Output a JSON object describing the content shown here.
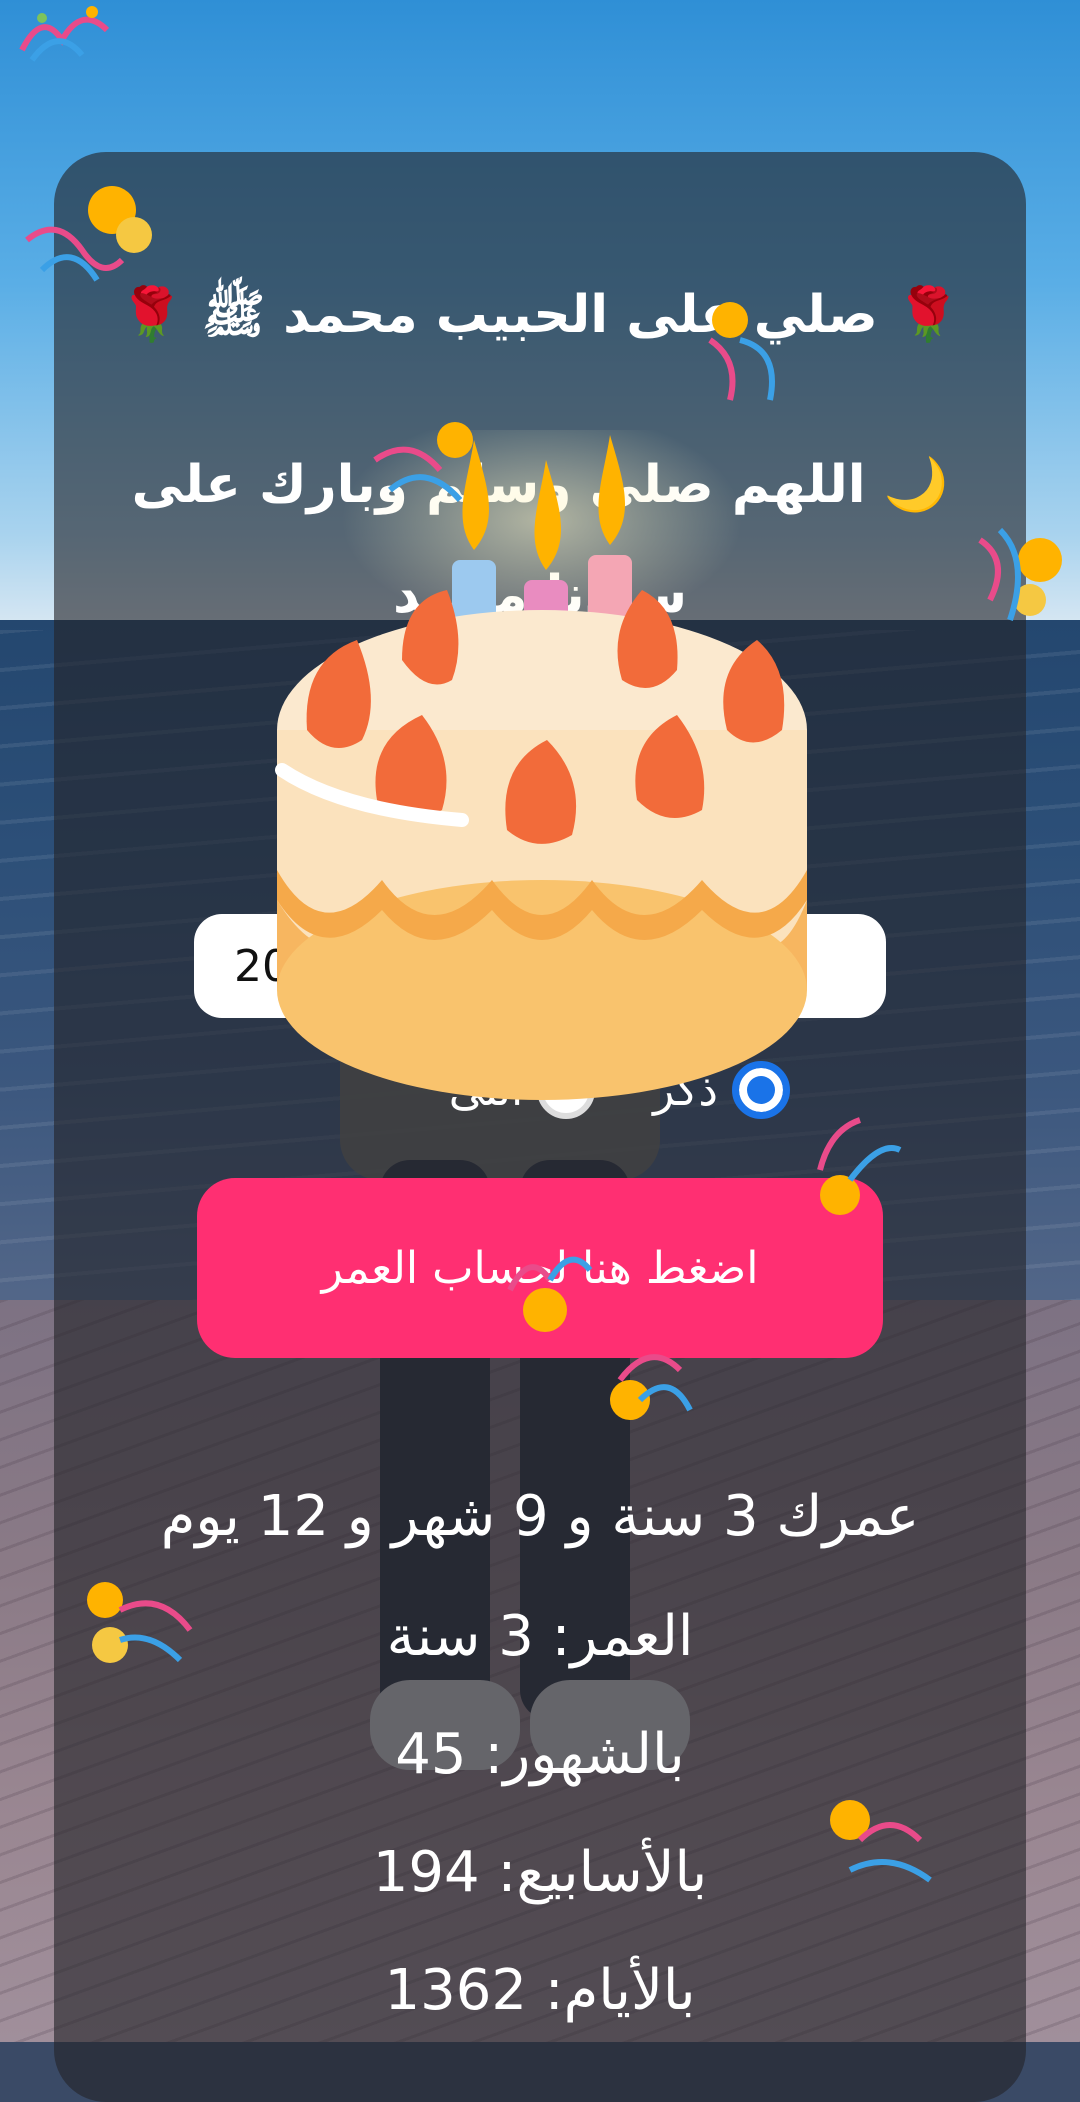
{
  "header": {
    "salawat_line": "🌹 صلي على الحبيب محمد ﷺ 🌹",
    "dua_line": "🌙 اللهم صلي وسلم وبارك على سيدنا محمد"
  },
  "birthdate_input": {
    "value": "20                                                2"
  },
  "gender": {
    "options": [
      {
        "label": "ذكر",
        "selected": true
      },
      {
        "label": "انثى",
        "selected": false
      }
    ]
  },
  "calculate_button": {
    "label": "اضغط هنا لحساب العمر"
  },
  "results": {
    "summary": "عمرك 3 سنة و 9 شهر و 12 يوم",
    "years": "العمر: 3 سنة",
    "months": "بالشهور: 45",
    "weeks": "بالأسابيع: 194",
    "days": "بالأيام: 1362"
  },
  "colors": {
    "button": "#ff2f72",
    "radio_selected": "#1a73e8",
    "card_overlay": "rgba(35,35,40,0.62)"
  },
  "icons": [
    "rose-icon",
    "crescent-moon-icon",
    "birthday-cake-icon",
    "confetti-popper-icon"
  ]
}
